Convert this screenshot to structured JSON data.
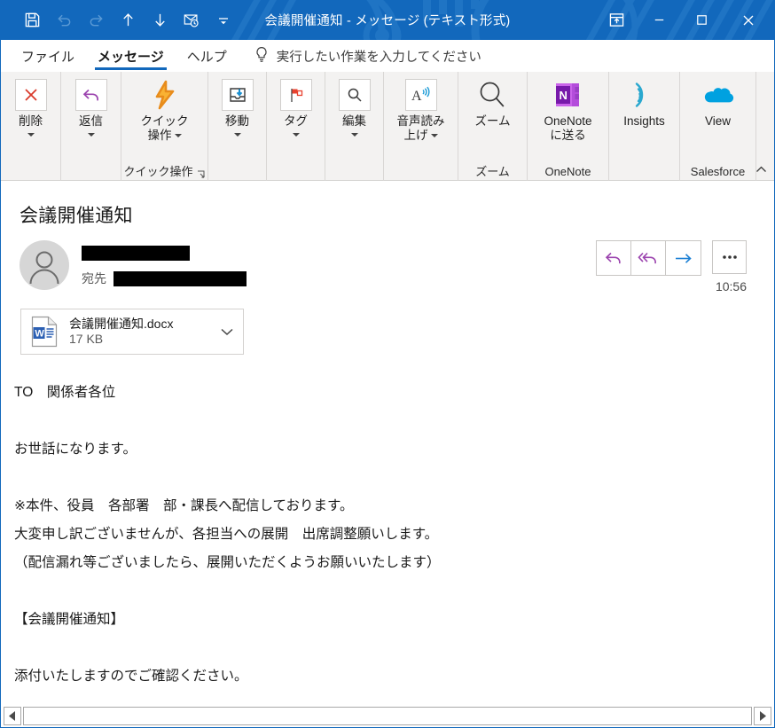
{
  "window": {
    "title": "会議開催通知  -  メッセージ (テキスト形式)",
    "accent_color": "#1268bc",
    "quick_access": [
      {
        "name": "save-icon",
        "label": "上書き保存",
        "enabled": true
      },
      {
        "name": "undo-icon",
        "label": "元に戻す",
        "enabled": false
      },
      {
        "name": "redo-icon",
        "label": "やり直し",
        "enabled": false
      },
      {
        "name": "previous-item-icon",
        "label": "前のアイテム",
        "enabled": true
      },
      {
        "name": "next-item-icon",
        "label": "次のアイテム",
        "enabled": true
      },
      {
        "name": "mail-reminder-icon",
        "label": "フラグ",
        "enabled": true
      },
      {
        "name": "customize-quick-access-icon",
        "label": "クイック アクセス ツール バーのユーザー設定",
        "enabled": true
      }
    ],
    "controls": [
      {
        "name": "ribbon-display-options-button",
        "label": "リボンの表示オプション"
      },
      {
        "name": "minimize-button",
        "label": "最小化"
      },
      {
        "name": "maximize-button",
        "label": "最大化"
      },
      {
        "name": "close-button",
        "label": "閉じる"
      }
    ]
  },
  "tabs": [
    {
      "label": "ファイル",
      "active": false
    },
    {
      "label": "メッセージ",
      "active": true
    },
    {
      "label": "ヘルプ",
      "active": false
    }
  ],
  "tell_me": {
    "icon": "lightbulb-icon",
    "placeholder": "実行したい作業を入力してください"
  },
  "ribbon": {
    "collapse_label": "リボンを折りたたむ",
    "groups": [
      {
        "name": "delete",
        "group_label": "",
        "has_launcher": false,
        "buttons": [
          {
            "name": "delete-button",
            "label": "削除",
            "label2": "",
            "icon": "delete-x-icon",
            "has_caret": true,
            "boxed": true
          }
        ]
      },
      {
        "name": "respond",
        "group_label": "",
        "has_launcher": false,
        "buttons": [
          {
            "name": "reply-button",
            "label": "返信",
            "label2": "",
            "icon": "reply-arrow-icon",
            "has_caret": true,
            "boxed": true
          }
        ]
      },
      {
        "name": "quick-steps",
        "group_label": "クイック操作",
        "has_launcher": true,
        "buttons": [
          {
            "name": "quick-steps-button",
            "label": "クイック",
            "label2": "操作",
            "icon": "lightning-bolt-icon",
            "has_caret": false,
            "inline_caret": true,
            "boxed": false
          }
        ]
      },
      {
        "name": "move",
        "group_label": "",
        "has_launcher": false,
        "buttons": [
          {
            "name": "move-button",
            "label": "移動",
            "label2": "",
            "icon": "move-to-folder-icon",
            "has_caret": true,
            "boxed": true
          }
        ]
      },
      {
        "name": "tags",
        "group_label": "",
        "has_launcher": false,
        "buttons": [
          {
            "name": "tags-button",
            "label": "タグ",
            "label2": "",
            "icon": "red-flag-icon",
            "has_caret": true,
            "boxed": true
          }
        ]
      },
      {
        "name": "editing",
        "group_label": "",
        "has_launcher": false,
        "buttons": [
          {
            "name": "editing-button",
            "label": "編集",
            "label2": "",
            "icon": "magnifier-icon",
            "has_caret": true,
            "boxed": true
          }
        ]
      },
      {
        "name": "speech",
        "group_label": "",
        "has_launcher": false,
        "buttons": [
          {
            "name": "read-aloud-button",
            "label": "音声読み",
            "label2": "上げ",
            "icon": "read-aloud-icon",
            "has_caret": false,
            "inline_caret": true,
            "boxed": true
          }
        ]
      },
      {
        "name": "zoom",
        "group_label": "ズーム",
        "has_launcher": false,
        "buttons": [
          {
            "name": "zoom-button",
            "label": "ズーム",
            "label2": "",
            "icon": "zoom-magnifier-icon",
            "has_caret": false,
            "boxed": false
          }
        ]
      },
      {
        "name": "onenote",
        "group_label": "OneNote",
        "has_launcher": false,
        "buttons": [
          {
            "name": "send-to-onenote-button",
            "label": "OneNote",
            "label2": "に送る",
            "icon": "onenote-icon",
            "has_caret": false,
            "boxed": false
          }
        ]
      },
      {
        "name": "insights",
        "group_label": "",
        "has_launcher": false,
        "buttons": [
          {
            "name": "insights-button",
            "label": "Insights",
            "label2": "",
            "icon": "insights-icon",
            "has_caret": false,
            "boxed": false
          }
        ]
      },
      {
        "name": "salesforce",
        "group_label": "Salesforce",
        "has_launcher": false,
        "buttons": [
          {
            "name": "salesforce-view-button",
            "label": "View",
            "label2": "",
            "icon": "salesforce-cloud-icon",
            "has_caret": false,
            "boxed": false
          }
        ]
      }
    ]
  },
  "message": {
    "subject": "会議開催通知",
    "sender_redacted": true,
    "to_label": "宛先",
    "recipient_redacted": true,
    "timestamp": "10:56",
    "actions": [
      {
        "name": "reply-button",
        "label": "返信",
        "icon": "reply-arrow-icon"
      },
      {
        "name": "reply-all-button",
        "label": "全員に返信",
        "icon": "reply-all-arrow-icon"
      },
      {
        "name": "forward-button",
        "label": "転送",
        "icon": "forward-arrow-icon"
      },
      {
        "name": "more-actions-button",
        "label": "その他の操作",
        "icon": "ellipsis-icon"
      }
    ],
    "attachment": {
      "filename": "会議開催通知.docx",
      "filesize": "17 KB",
      "icon": "word-document-icon",
      "dropdown_icon": "chevron-down-icon"
    },
    "body": "TO　関係者各位\n\nお世話になります。\n\n※本件、役員　各部署　部・課長へ配信しております。\n大変申し訳ございませんが、各担当への展開　出席調整願いします。\n（配信漏れ等ございましたら、展開いただくようお願いいたします）\n\n【会議開催通知】\n\n添付いたしますのでご確認ください。"
  },
  "scrollbar": {
    "left_arrow": "scroll-left-icon",
    "right_arrow": "scroll-right-icon"
  }
}
